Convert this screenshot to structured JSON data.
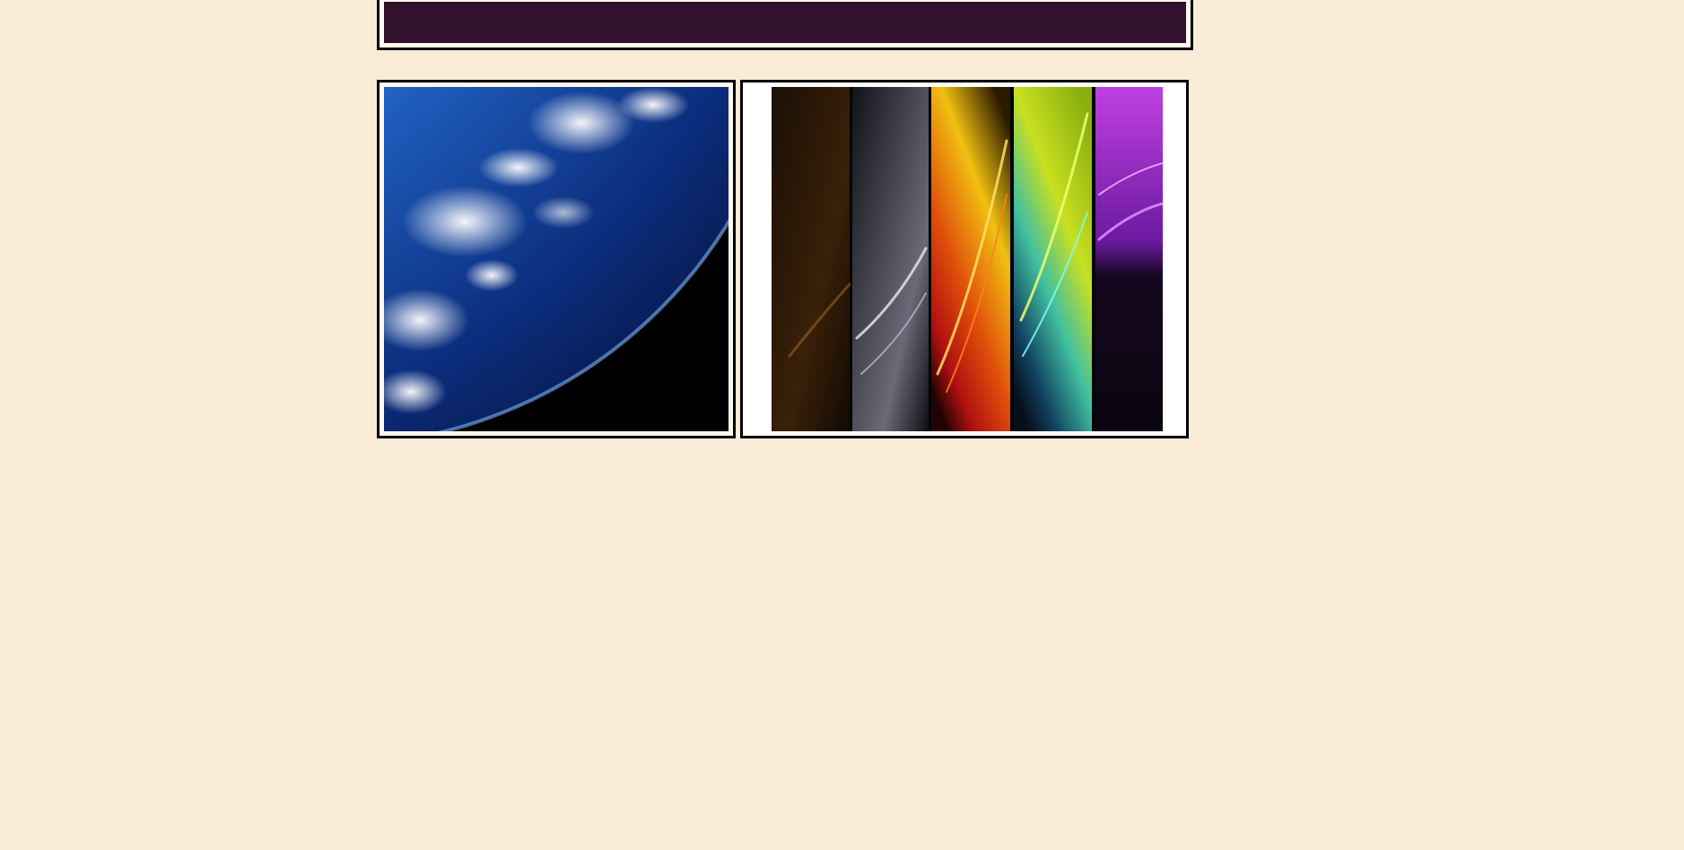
{
  "colors": {
    "page_background": "#faebd7",
    "banner": "#31112c",
    "frame_border": "#000000",
    "frame_matte": "#fff8ef"
  },
  "gallery": {
    "items": [
      {
        "icon": "earth-from-space-image"
      },
      {
        "icon": "rainbow-light-streaks-image"
      }
    ]
  }
}
